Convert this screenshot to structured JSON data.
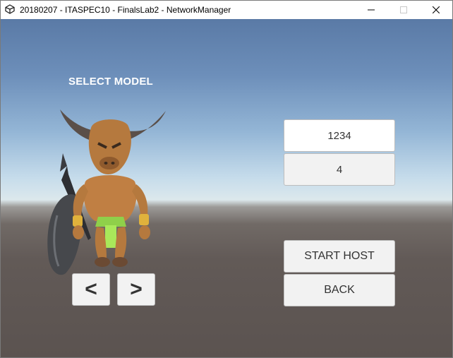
{
  "window": {
    "title": "20180207 - ITASPEC10 - FinalsLab2 - NetworkManager",
    "icon": "unity-icon",
    "controls": [
      "minimize-icon",
      "maximize-icon",
      "close-icon"
    ]
  },
  "scene": {
    "select_label": "SELECT MODEL",
    "character": "minotaur-with-spear-and-shield"
  },
  "form": {
    "port_value": "1234",
    "players_value": "4",
    "start_host_label": "START HOST",
    "back_label": "BACK"
  },
  "navigation": {
    "prev_label": "<",
    "next_label": ">"
  },
  "colors": {
    "sky_top": "#5a7aa6",
    "horizon": "#dce8ec",
    "ground": "#5b5350",
    "button_bg": "#f2f2f2"
  }
}
